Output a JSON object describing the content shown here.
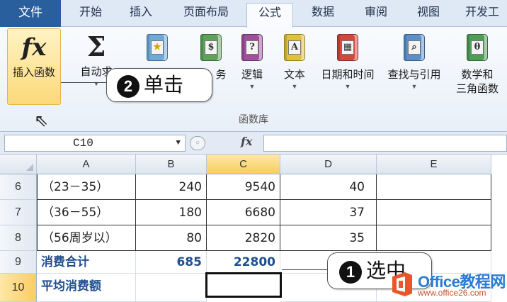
{
  "ribbon": {
    "tabs": [
      "文件",
      "开始",
      "插入",
      "页面布局",
      "公式",
      "数据",
      "审阅",
      "视图",
      "开发工"
    ],
    "active_tab": "公式",
    "buttons": {
      "insert_function": "插入函数",
      "autosum": "自动求",
      "financial": "务",
      "logical": "逻辑",
      "text": "文本",
      "datetime": "日期和时间",
      "lookup": "查找与引用",
      "math_line1": "数学和",
      "math_line2": "三角函数"
    },
    "group_label": "函数库",
    "colors": {
      "file_tab": "#2a5f9e",
      "selected_button": "#fcd97a"
    }
  },
  "formula_bar": {
    "name_box": "C10",
    "fx_label": "fx",
    "formula": ""
  },
  "sheet": {
    "columns": [
      "A",
      "B",
      "C",
      "D",
      "E"
    ],
    "selected_column": "C",
    "selected_row": "10",
    "rows": [
      {
        "row": "6",
        "A": "（23－35）",
        "B": "240",
        "C": "9540",
        "D": "40"
      },
      {
        "row": "7",
        "A": "（36－55）",
        "B": "180",
        "C": "6680",
        "D": "37"
      },
      {
        "row": "8",
        "A": "（56周岁以）",
        "B": "80",
        "C": "2820",
        "D": "35"
      },
      {
        "row": "9",
        "A": "消费合计",
        "B": "685",
        "C": "22800",
        "D": ""
      },
      {
        "row": "10",
        "A": "平均消费额",
        "B": "",
        "C": "",
        "D": ""
      }
    ]
  },
  "callouts": {
    "step1": {
      "number": "1",
      "text": "选中"
    },
    "step2": {
      "number": "2",
      "text": "单击"
    }
  },
  "watermark": {
    "title": "Office教程网",
    "url": "www.office26.com"
  }
}
